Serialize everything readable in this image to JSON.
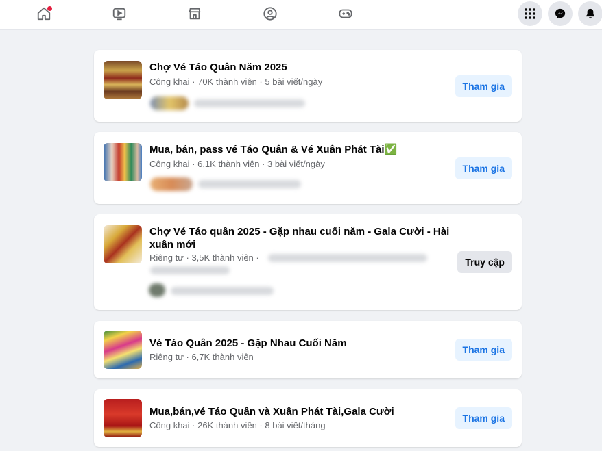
{
  "nav": {
    "icons": [
      "home-icon",
      "watch-icon",
      "marketplace-icon",
      "groups-icon",
      "gaming-icon",
      "menu-grid-icon",
      "messenger-icon",
      "notifications-icon"
    ]
  },
  "groups": [
    {
      "name": "Chợ Vé Táo Quân Năm 2025",
      "meta": "Công khai · 70K thành viên · 5 bài viết/ngày",
      "button": "Tham gia"
    },
    {
      "name": "Mua, bán, pass vé Táo Quân & Vé Xuân Phát Tài✅",
      "meta": "Công khai · 6,1K thành viên · 3 bài viết/ngày",
      "button": "Tham gia"
    },
    {
      "name": "Chợ Vé Táo quân 2025 - Gặp nhau cuối năm - Gala Cười - Hài xuân mới",
      "meta": "Riêng tư · 3,5K thành viên ·",
      "button": "Truy cập"
    },
    {
      "name": "Vé Táo Quân 2025 - Gặp Nhau Cuối Năm",
      "meta": "Riêng tư · 6,7K thành viên",
      "button": "Tham gia"
    },
    {
      "name": "Mua,bán,vé Táo Quân và Xuân Phát Tài,Gala Cười",
      "meta": "Công khai · 26K thành viên · 8 bài viết/tháng",
      "button": "Tham gia"
    }
  ],
  "colors": {
    "join_bg": "#e7f3ff",
    "join_text": "#1b74e4",
    "visit_bg": "#e4e6eb",
    "notification_dot": "#e41e3f"
  }
}
